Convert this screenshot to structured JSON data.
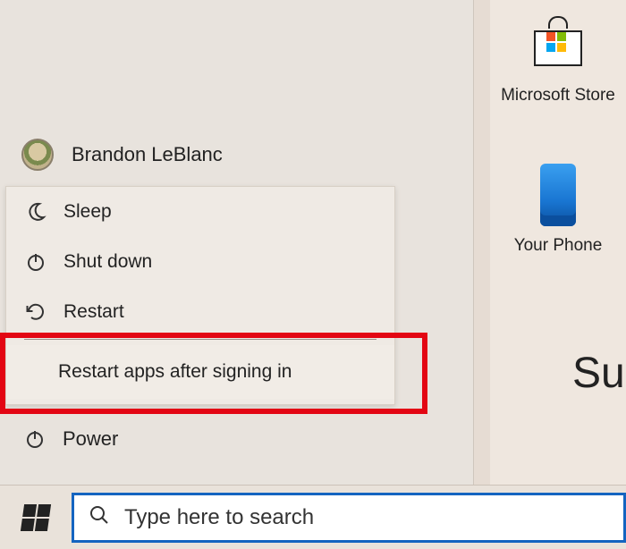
{
  "user": {
    "name": "Brandon LeBlanc"
  },
  "powerMenu": {
    "sleep": "Sleep",
    "shutdown": "Shut down",
    "restart": "Restart",
    "restartApps": "Restart apps after signing in"
  },
  "sidebar": {
    "powerLabel": "Power"
  },
  "search": {
    "placeholder": "Type here to search"
  },
  "tiles": {
    "store": "Microsoft Store",
    "yourPhone": "Your Phone"
  },
  "snippet": "Su"
}
